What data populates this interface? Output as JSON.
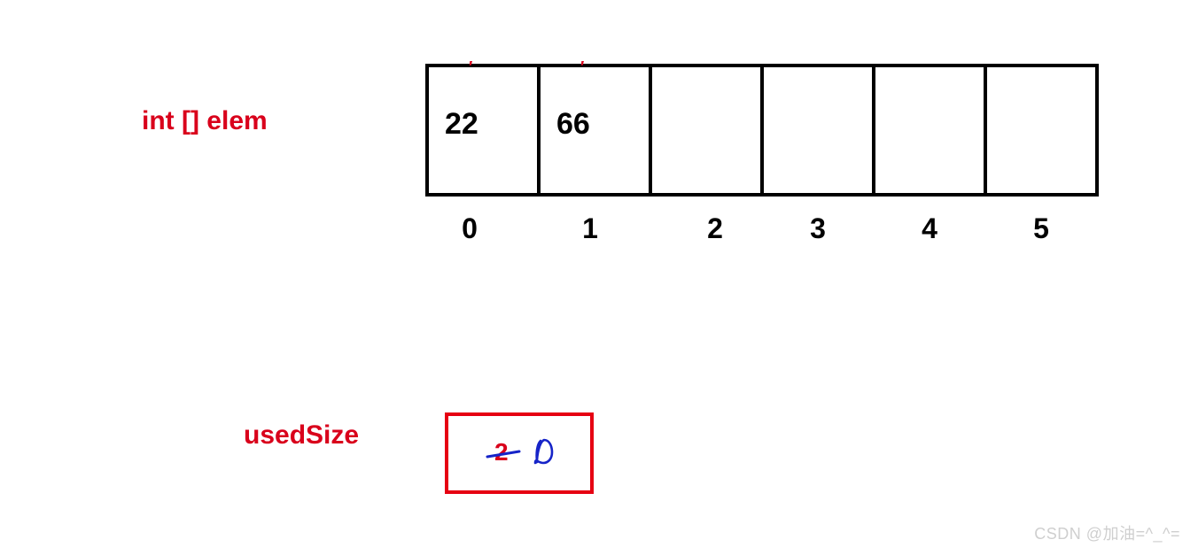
{
  "labels": {
    "elem": "int []   elem",
    "usedSize": "usedSize"
  },
  "array": {
    "cells": [
      "22",
      "66",
      "",
      "",
      "",
      ""
    ],
    "indices": [
      "0",
      "1",
      "2",
      "3",
      "4",
      "5"
    ],
    "ticks": [
      true,
      true,
      false,
      false,
      false,
      false
    ]
  },
  "usedSize": {
    "crossedOut": "2",
    "newValueGlyph": "zero-handwritten"
  },
  "watermark": "CSDN @加油=^_^="
}
